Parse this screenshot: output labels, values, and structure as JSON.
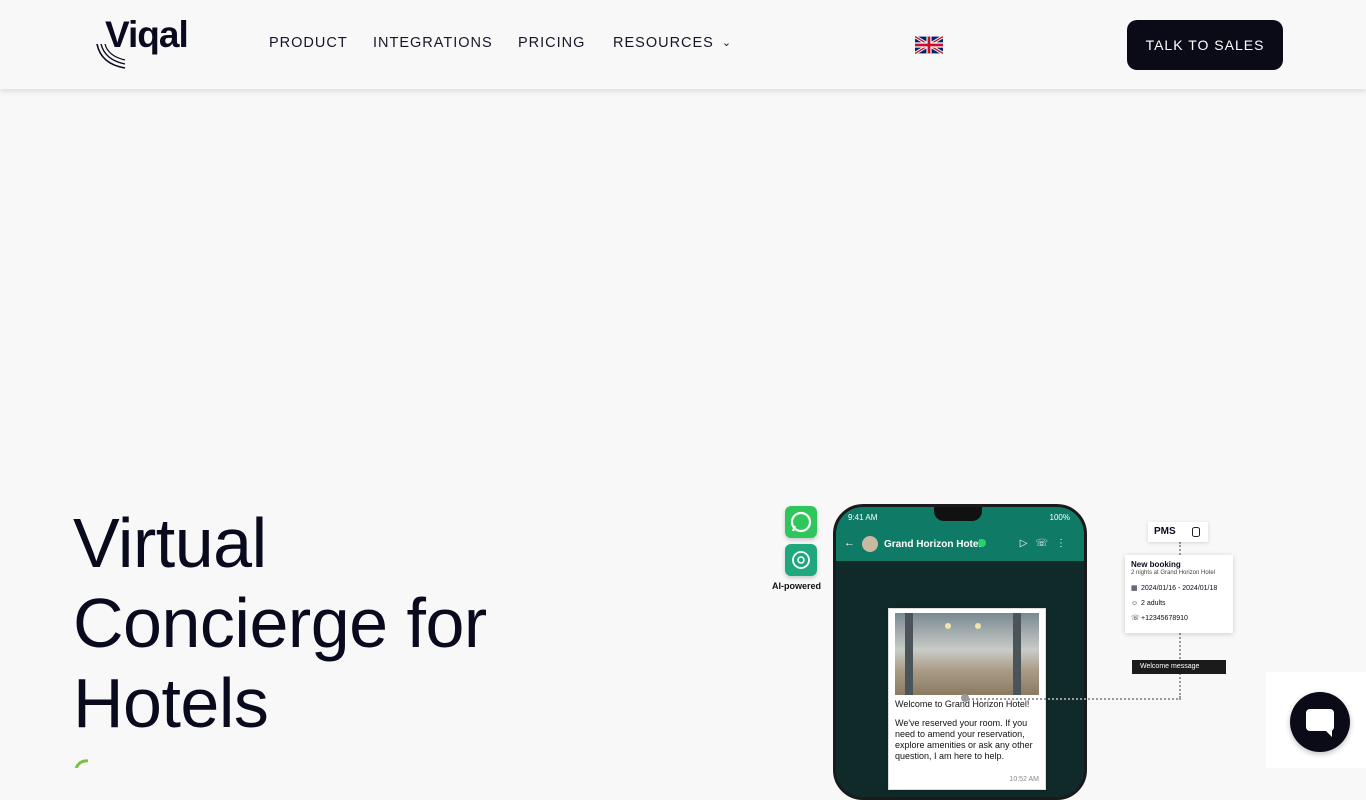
{
  "header": {
    "logo_text": "Viqal",
    "nav": [
      {
        "label": "PRODUCT"
      },
      {
        "label": "INTEGRATIONS"
      },
      {
        "label": "PRICING"
      },
      {
        "label": "RESOURCES",
        "has_dropdown": true
      }
    ],
    "language_flag": "uk-flag-icon",
    "cta_label": "TALK TO SALES"
  },
  "hero": {
    "title_lines": [
      "Virtual",
      "Concierge for",
      "Hotels"
    ]
  },
  "illustration": {
    "ai_label": "AI-powered",
    "phone": {
      "status_time": "9:41 AM",
      "status_battery": "100%",
      "contact_name": "Grand Horizon Hotel",
      "message_greeting": "Welcome to Grand Horizon Hotel!",
      "message_body": "We've reserved your room. If you need to amend your reservation, explore amenities or ask any other question, I am here to help.",
      "message_time": "10:52 AM"
    },
    "pms_label": "PMS",
    "booking": {
      "title": "New booking",
      "subtitle": "2 nights at Grand Horizon Hotel",
      "dates": "2024/01/16 - 2024/01/18",
      "guests": "2 adults",
      "phone": "+12345678910"
    },
    "welcome_tag": "Welcome message"
  },
  "colors": {
    "background": "#f8f8f8",
    "cta_bg": "#0b0b18",
    "whatsapp_green": "#2fc65c",
    "phone_header": "#0f7a66"
  }
}
